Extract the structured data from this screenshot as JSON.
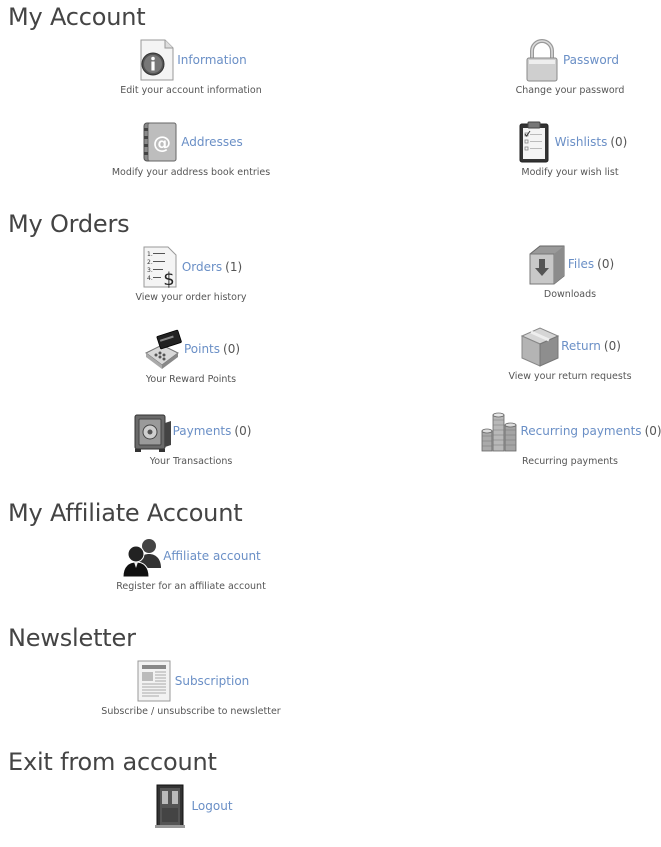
{
  "sections": {
    "my_account": "My Account",
    "my_orders": "My Orders",
    "my_affiliate": "My Affiliate Account",
    "newsletter": "Newsletter",
    "exit": "Exit from account"
  },
  "account": {
    "information": {
      "label": "Information",
      "desc": "Edit your account information",
      "icon": "info-document-icon"
    },
    "password": {
      "label": "Password",
      "desc": "Change your password",
      "icon": "padlock-icon"
    },
    "addresses": {
      "label": "Addresses",
      "desc": "Modify your address book entries",
      "icon": "address-book-icon"
    },
    "wishlists": {
      "label": "Wishlists",
      "count": "(0)",
      "desc": "Modify your wish list",
      "icon": "clipboard-checklist-icon"
    }
  },
  "orders": {
    "orders": {
      "label": "Orders",
      "count": "(1)",
      "desc": "View your order history",
      "icon": "order-list-dollar-icon"
    },
    "files": {
      "label": "Files",
      "count": "(0)",
      "desc": "Downloads",
      "icon": "download-folder-icon"
    },
    "points": {
      "label": "Points",
      "count": "(0)",
      "desc": "Your Reward Points",
      "icon": "card-terminal-icon"
    },
    "return": {
      "label": "Return",
      "count": "(0)",
      "desc": "View your return requests",
      "icon": "box-icon"
    },
    "payments": {
      "label": "Payments",
      "count": "(0)",
      "desc": "Your Transactions",
      "icon": "safe-icon"
    },
    "recurring": {
      "label": "Recurring payments",
      "count": "(0)",
      "desc": "Recurring payments",
      "icon": "coin-stacks-icon"
    }
  },
  "affiliate": {
    "affiliate_account": {
      "label": "Affiliate account",
      "desc": "Register for an affiliate account",
      "icon": "users-icon"
    }
  },
  "newsletter": {
    "subscription": {
      "label": "Subscription",
      "desc": "Subscribe / unsubscribe to newsletter",
      "icon": "newspaper-icon"
    }
  },
  "exit": {
    "logout": {
      "label": "Logout",
      "icon": "door-icon"
    }
  },
  "colors": {
    "link": "#6a8fc6",
    "heading": "#444444",
    "text": "#555555"
  }
}
